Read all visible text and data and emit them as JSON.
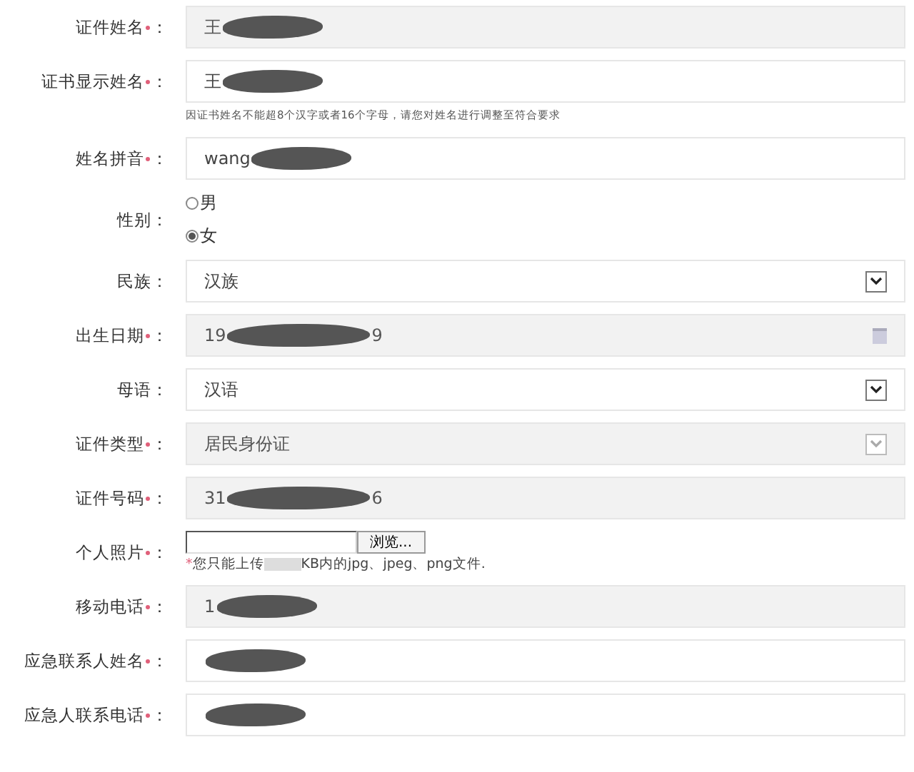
{
  "fields": [
    {
      "kind": "text",
      "label": "证件姓名",
      "colon": "：",
      "required": true,
      "disabled": true,
      "value": "王",
      "redacted": true
    },
    {
      "kind": "text",
      "label": "证书显示姓名",
      "colon": "：",
      "required": true,
      "disabled": false,
      "value": "王",
      "redacted": true
    },
    {
      "kind": "note",
      "text": "因证书姓名不能超8个汉字或者16个字母，请您对姓名进行调整至符合要求"
    },
    {
      "kind": "text",
      "label": "姓名拼音",
      "colon": "：",
      "required": true,
      "disabled": false,
      "value": "wang",
      "redacted": true
    },
    {
      "kind": "radio",
      "label": "性别",
      "colon": "：",
      "required": false,
      "options": [
        {
          "label": "男",
          "selected": false
        },
        {
          "label": "女",
          "selected": true
        }
      ]
    },
    {
      "kind": "select",
      "label": "民族",
      "colon": "：",
      "required": false,
      "disabled": false,
      "value": "汉族"
    },
    {
      "kind": "date",
      "label": "出生日期",
      "colon": "：",
      "required": true,
      "disabled": true,
      "value": "19",
      "redacted": true,
      "suffix": "9"
    },
    {
      "kind": "select",
      "label": "母语",
      "colon": "：",
      "required": false,
      "disabled": false,
      "value": "汉语"
    },
    {
      "kind": "select",
      "label": "证件类型",
      "colon": "：",
      "required": true,
      "disabled": true,
      "value": "居民身份证"
    },
    {
      "kind": "text",
      "label": "证件号码",
      "colon": "：",
      "required": true,
      "disabled": true,
      "value": "31",
      "redacted": true,
      "suffix": "6"
    },
    {
      "kind": "file",
      "label": "个人照片",
      "colon": "：",
      "required": true,
      "button": "浏览...",
      "note_mark": "*",
      "note_before": "您只能上传",
      "note_after": "KB内的jpg、jpeg、png文件."
    },
    {
      "kind": "text",
      "label": "移动电话",
      "colon": "：",
      "required": true,
      "disabled": true,
      "value": "1",
      "redacted": true
    },
    {
      "kind": "text",
      "label": "应急联系人姓名",
      "colon": "：",
      "required": true,
      "disabled": false,
      "redacted": true
    },
    {
      "kind": "text",
      "label": "应急人联系电话",
      "colon": "：",
      "required": true,
      "disabled": false,
      "redacted": true
    }
  ]
}
